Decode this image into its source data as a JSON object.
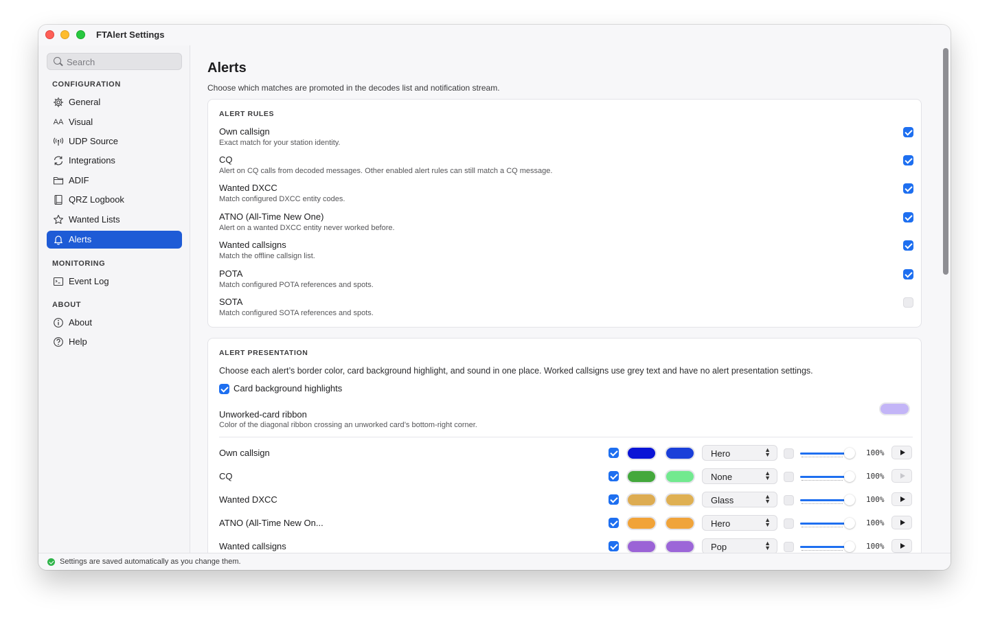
{
  "window": {
    "title": "FTAlert Settings"
  },
  "sidebar": {
    "search_placeholder": "Search",
    "sections": [
      {
        "heading": "CONFIGURATION"
      },
      {
        "heading": "MONITORING"
      },
      {
        "heading": "ABOUT"
      }
    ],
    "items": [
      {
        "label": "General",
        "icon": "gear-icon"
      },
      {
        "label": "Visual",
        "icon": "text-size-icon",
        "glyph": "AA"
      },
      {
        "label": "UDP Source",
        "icon": "antenna-icon"
      },
      {
        "label": "Integrations",
        "icon": "sync-icon"
      },
      {
        "label": "ADIF",
        "icon": "folder-icon"
      },
      {
        "label": "QRZ Logbook",
        "icon": "book-icon"
      },
      {
        "label": "Wanted Lists",
        "icon": "star-icon"
      },
      {
        "label": "Alerts",
        "icon": "bell-icon",
        "active": true
      },
      {
        "label": "Event Log",
        "icon": "terminal-icon"
      },
      {
        "label": "About",
        "icon": "info-icon"
      },
      {
        "label": "Help",
        "icon": "question-icon"
      }
    ]
  },
  "main": {
    "title": "Alerts",
    "subtitle": "Choose which matches are promoted in the decodes list and notification stream.",
    "rules": {
      "heading": "ALERT RULES",
      "items": [
        {
          "title": "Own callsign",
          "desc": "Exact match for your station identity.",
          "checked": true
        },
        {
          "title": "CQ",
          "desc": "Alert on CQ calls from decoded messages. Other enabled alert rules can still match a CQ message.",
          "checked": true
        },
        {
          "title": "Wanted DXCC",
          "desc": "Match configured DXCC entity codes.",
          "checked": true
        },
        {
          "title": "ATNO (All-Time New One)",
          "desc": "Alert on a wanted DXCC entity never worked before.",
          "checked": true
        },
        {
          "title": "Wanted callsigns",
          "desc": "Match the offline callsign list.",
          "checked": true
        },
        {
          "title": "POTA",
          "desc": "Match configured POTA references and spots.",
          "checked": true
        },
        {
          "title": "SOTA",
          "desc": "Match configured SOTA references and spots.",
          "checked": false
        }
      ]
    },
    "presentation": {
      "heading": "ALERT PRESENTATION",
      "desc": "Choose each alert’s border color, card background highlight, and sound in one place. Worked callsigns use grey text and have no alert presentation settings.",
      "card_highlights_label": "Card background highlights",
      "card_highlights_checked": true,
      "ribbon_title": "Unworked-card ribbon",
      "ribbon_desc": "Color of the diagonal ribbon crossing an unworked card’s bottom-right corner.",
      "ribbon_color": "#c3b5f7",
      "rows": [
        {
          "name": "Own callsign",
          "enabled": true,
          "border_color": "#0a14d6",
          "bg_color": "#1a3fd9",
          "sound": "Hero",
          "muted": false,
          "volume": 1.0,
          "volume_label": "100%",
          "play_enabled": true
        },
        {
          "name": "CQ",
          "enabled": true,
          "border_color": "#44a83c",
          "bg_color": "#72e98f",
          "sound": "None",
          "muted": false,
          "volume": 1.0,
          "volume_label": "100%",
          "play_enabled": false
        },
        {
          "name": "Wanted DXCC",
          "enabled": true,
          "border_color": "#ddac52",
          "bg_color": "#dfb053",
          "sound": "Glass",
          "muted": false,
          "volume": 1.0,
          "volume_label": "100%",
          "play_enabled": true
        },
        {
          "name": "ATNO (All-Time New On...",
          "enabled": true,
          "border_color": "#f1a338",
          "bg_color": "#f0a43b",
          "sound": "Hero",
          "muted": false,
          "volume": 1.0,
          "volume_label": "100%",
          "play_enabled": true
        },
        {
          "name": "Wanted callsigns",
          "enabled": true,
          "border_color": "#9b63d6",
          "bg_color": "#9c66d8",
          "sound": "Pop",
          "muted": false,
          "volume": 1.0,
          "volume_label": "100%",
          "play_enabled": true
        }
      ]
    }
  },
  "status": {
    "text": "Settings are saved automatically as you change them.",
    "color": "#2fb44a"
  },
  "accent": "#1e5bd6"
}
